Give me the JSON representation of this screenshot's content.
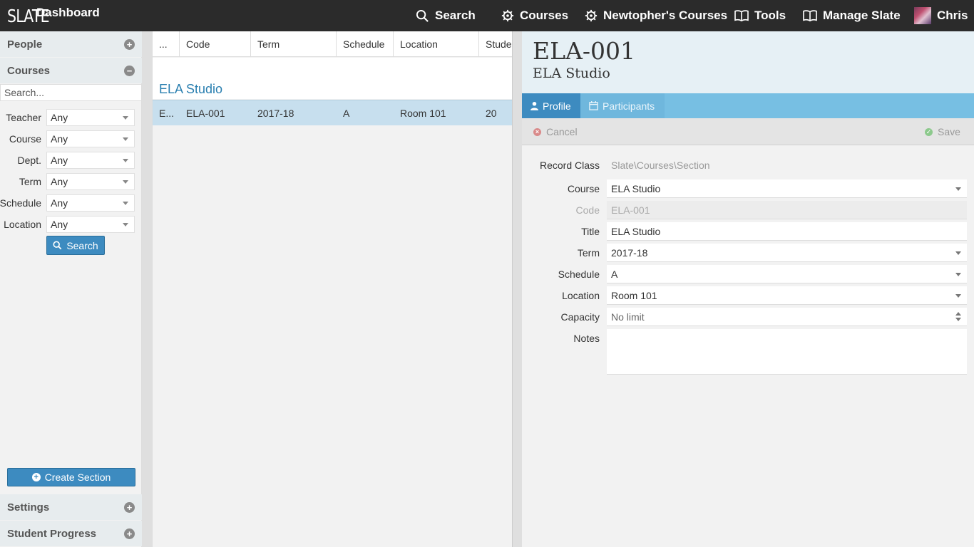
{
  "topbar": {
    "logo": "SLATE",
    "dashboard": "Dashboard",
    "nav": {
      "search": "Search",
      "courses": "Courses",
      "my_courses": "Newtopher's Courses",
      "tools": "Tools",
      "manage": "Manage Slate",
      "user": "Chris"
    }
  },
  "sidebar": {
    "people": "People",
    "courses": "Courses",
    "search_placeholder": "Search...",
    "filters": [
      {
        "label": "Teacher",
        "value": "Any"
      },
      {
        "label": "Course",
        "value": "Any"
      },
      {
        "label": "Dept.",
        "value": "Any"
      },
      {
        "label": "Term",
        "value": "Any"
      },
      {
        "label": "Schedule",
        "value": "Any"
      },
      {
        "label": "Location",
        "value": "Any"
      }
    ],
    "search_button": "Search",
    "create_button": "Create Section",
    "settings": "Settings",
    "student_progress": "Student Progress"
  },
  "grid": {
    "columns": [
      "...",
      "Code",
      "Term",
      "Schedule",
      "Location",
      "Stude"
    ],
    "group": "ELA Studio",
    "rows": [
      {
        "title": "E...",
        "code": "ELA-001",
        "term": "2017-18",
        "schedule": "A",
        "location": "Room 101",
        "students": "20"
      }
    ]
  },
  "detail": {
    "title": "ELA-001",
    "subtitle": "ELA Studio",
    "tabs": {
      "profile": "Profile",
      "participants": "Participants"
    },
    "actions": {
      "cancel": "Cancel",
      "save": "Save"
    },
    "fields": {
      "record_class": {
        "label": "Record Class",
        "value": "Slate\\Courses\\Section"
      },
      "course": {
        "label": "Course",
        "value": "ELA Studio"
      },
      "code": {
        "label": "Code",
        "value": "ELA-001"
      },
      "title": {
        "label": "Title",
        "value": "ELA Studio"
      },
      "term": {
        "label": "Term",
        "value": "2017-18"
      },
      "schedule": {
        "label": "Schedule",
        "value": "A"
      },
      "location": {
        "label": "Location",
        "value": "Room 101"
      },
      "capacity": {
        "label": "Capacity",
        "value": "No limit"
      },
      "notes": {
        "label": "Notes",
        "value": ""
      }
    }
  },
  "colors": {
    "topbar": "#2b2b2b",
    "accent": "#3d8bc0",
    "tabbar": "#77bfe3",
    "selected_row": "#c7dfee",
    "group_title": "#2a7fb0"
  }
}
